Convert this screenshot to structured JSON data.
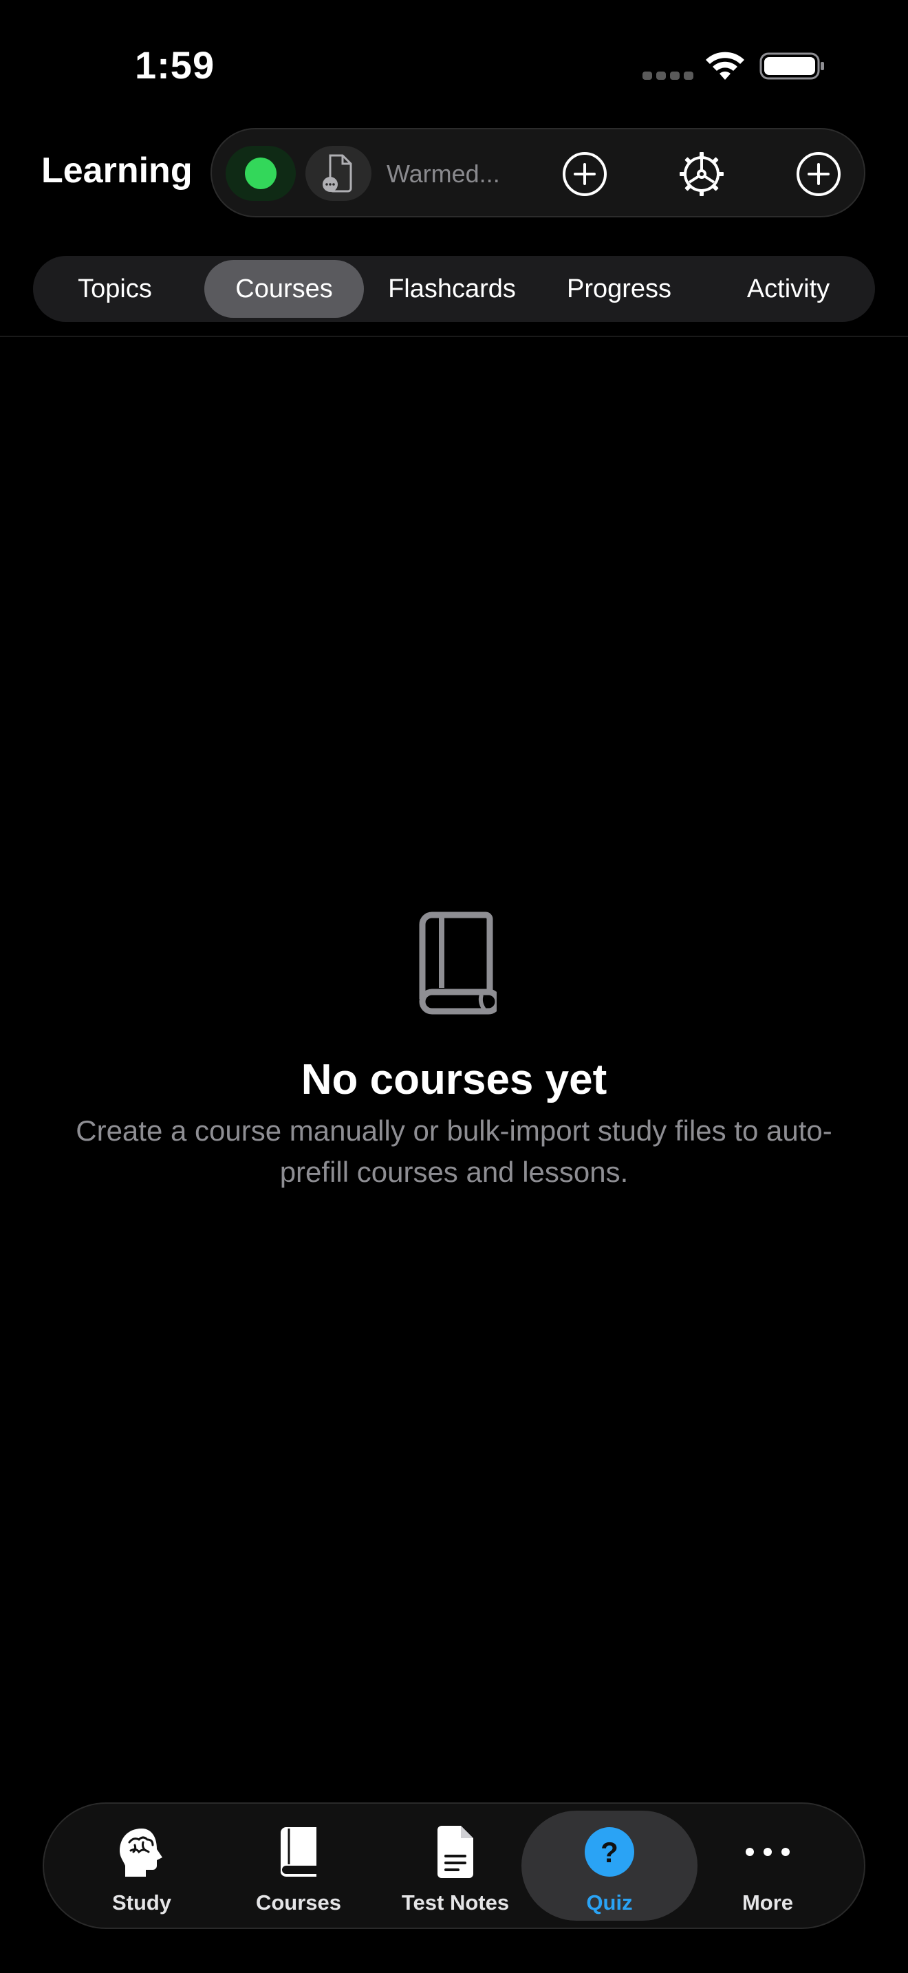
{
  "status_bar": {
    "time": "1:59"
  },
  "header": {
    "title": "Learning",
    "status_indicator_color": "#33d75a",
    "status_text": "Warmed...",
    "buttons": [
      "add-icon",
      "settings-icon",
      "add-icon"
    ]
  },
  "tabs": {
    "items": [
      {
        "label": "Topics"
      },
      {
        "label": "Courses"
      },
      {
        "label": "Flashcards"
      },
      {
        "label": "Progress"
      },
      {
        "label": "Activity"
      }
    ],
    "selected": "Courses"
  },
  "empty_state": {
    "icon": "book-icon",
    "title": "No courses yet",
    "description": "Create a course manually or bulk-import study files to auto-prefill courses and lessons."
  },
  "tab_bar": {
    "items": [
      {
        "label": "Study",
        "icon": "brain-head-icon"
      },
      {
        "label": "Courses",
        "icon": "book-icon"
      },
      {
        "label": "Test Notes",
        "icon": "document-icon"
      },
      {
        "label": "Quiz",
        "icon": "question-circle-icon"
      },
      {
        "label": "More",
        "icon": "ellipsis-icon"
      }
    ],
    "selected": "Quiz",
    "accent_color": "#2aa3f5"
  }
}
